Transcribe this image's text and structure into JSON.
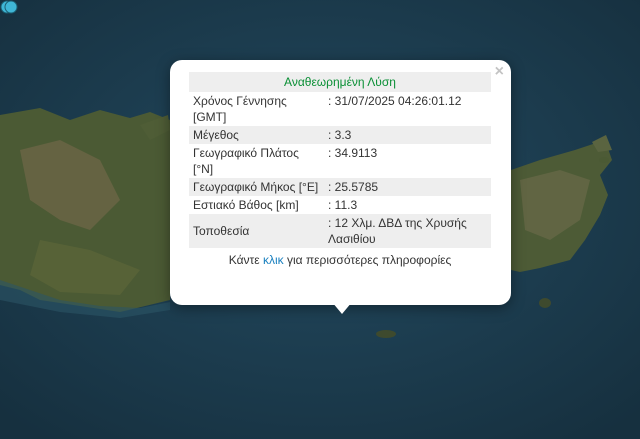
{
  "popup": {
    "title": "Αναθεωρημένη Λύση",
    "close_label": "×",
    "rows": [
      {
        "label": "Χρόνος Γέννησης [GMT]",
        "value": ": 31/07/2025 04:26:01.12"
      },
      {
        "label": "Μέγεθος",
        "value": ": 3.3"
      },
      {
        "label": "Γεωγραφικό Πλάτος [°N]",
        "value": ": 34.9113"
      },
      {
        "label": "Γεωγραφικό Μήκος [°E]",
        "value": ": 25.5785"
      },
      {
        "label": "Εστιακό Βάθος [km]",
        "value": ": 11.3"
      },
      {
        "label": "Τοποθεσία",
        "value": ": 12 Χλμ. ΔΒΔ της Χρυσής Λασιθίου"
      }
    ],
    "more_prefix": "Κάντε",
    "more_link": "κλικ",
    "more_suffix": "για περισσότερες πληροφορίες"
  },
  "colors": {
    "sea": "#1d3b4f",
    "title_green": "#0a8f35",
    "link_blue": "#1a80bf",
    "marker": "#3fb6d6"
  }
}
